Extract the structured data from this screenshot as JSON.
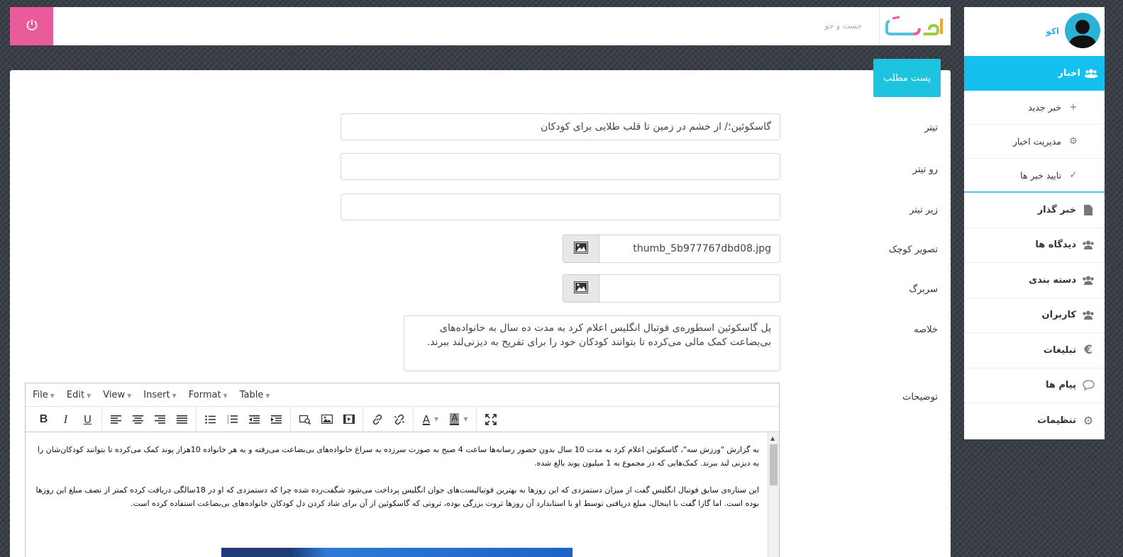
{
  "header": {
    "search_placeholder": "جست و جو",
    "logo_text": "اکـــو"
  },
  "sidebar": {
    "profile_name": "اکو",
    "active_item": "اخبار",
    "news_submenu": [
      {
        "label": "خبر جدید",
        "icon": "plus-icon"
      },
      {
        "label": "مدیریت اخبار",
        "icon": "gear-icon"
      },
      {
        "label": "تایید خبر ها",
        "icon": "check-icon"
      }
    ],
    "items": [
      {
        "label": "خبر گذار",
        "icon": "file-icon"
      },
      {
        "label": "دیدگاه ها",
        "icon": "users-icon"
      },
      {
        "label": "دسته بندی",
        "icon": "users-icon"
      },
      {
        "label": "کاربران",
        "icon": "users-icon"
      },
      {
        "label": "تبلیغات",
        "icon": "euro-icon"
      },
      {
        "label": "پیام ها",
        "icon": "chat-icon"
      },
      {
        "label": "تنظیمات",
        "icon": "cog-icon"
      }
    ]
  },
  "panel": {
    "tab_label": "پست مطلب",
    "fields": {
      "title_label": "تیتر",
      "title_value": "گاسکوئین؛/ از خشم در زمین تا قلب طلایی برای کودکان",
      "rotitr_label": "رو تیتر",
      "rotitr_value": "",
      "zirtitr_label": "زیر تیتر",
      "zirtitr_value": "",
      "thumb_label": "تصویر کوچک",
      "thumb_value": "thumb_5b977767dbd08.jpg",
      "header_img_label": "سربرگ",
      "header_img_value": "",
      "summary_label": "خلاصه",
      "summary_value": "پل گاسکوئین اسطوره‌ی فوتبال انگلیس اعلام کرد به مدت ده سال به خانواده‌های بی‌بضاعت کمک مالی می‌کرده تا بتوانند کودکان خود را برای تفریح به دیزنی‌لند ببرند.",
      "desc_label": "توضیحات"
    },
    "editor": {
      "menus": [
        "File",
        "Edit",
        "View",
        "Insert",
        "Format",
        "Table"
      ],
      "paragraph1": "به گزارش \"ورزش سه\"، گاسکوئین اعلام کرد به مدت 10 سال بدون حضور رسانه‌ها ساعت 4 صبح به صورت سرزده به سراغ خانواده‌های بی‌بضاعت می‌رفته و به هر خانواده 10هزار پوند کمک می‌کرده تا بتوانند کودکان‌شان را به دیزنی لند ببرند. کمک‌هایی که در مجموع به 1 میلیون پوند بالغ شده.",
      "paragraph2": "این ستاره‌ی سابق فوتبال انگلیس گفت از میزان دستمزدی که این روزها به بهترین فوتبالیست‌های جوان انگلیس پرداخت می‌شود شگفت‌زده شده چرا که دستمزدی که او در 18سالگی دریافت کرده کمتر از نصف مبلغ این روزها بوده است. اما گازا گفت با اینحال، مبلغ دریافتی توسط او با استاندارد آن روزها ثروت بزرگی بوده، ثروتی که گاسکوئین از آن برای شاد کردن دل کودکان خانواده‌های بی‌بضاعت استفاده کرده است."
    }
  },
  "colors": {
    "accent_cyan": "#14c1ee",
    "power_pink": "#e95c9c",
    "tab_cyan": "#1ec3e0"
  }
}
